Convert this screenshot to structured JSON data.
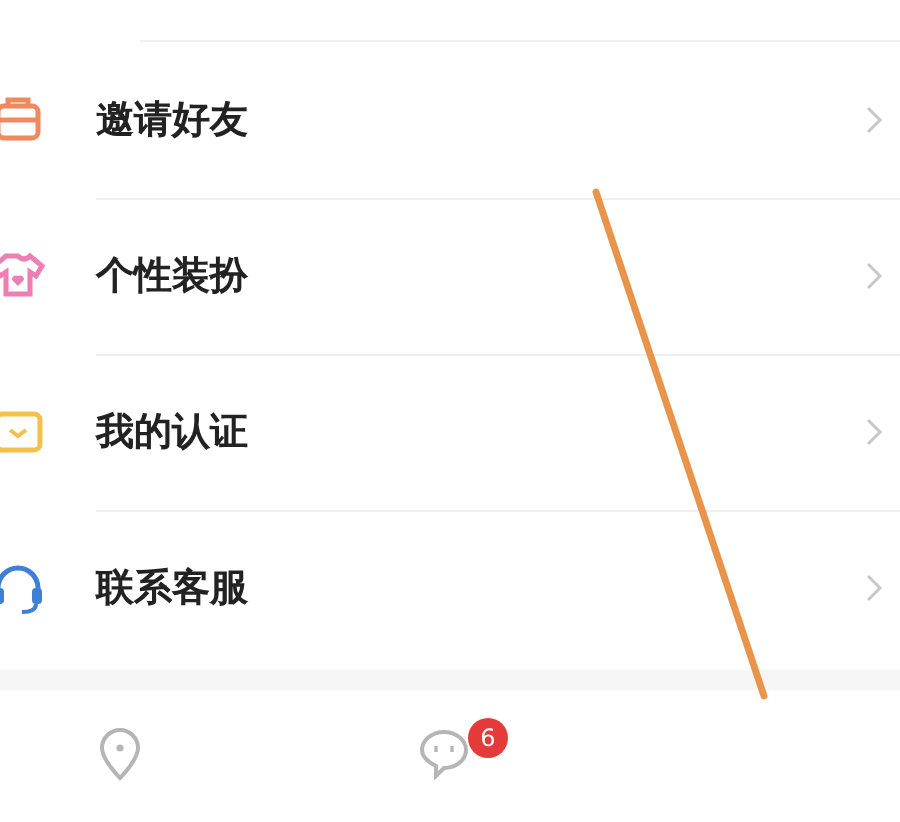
{
  "menu": [
    {
      "label": "邀请好友",
      "kind": "gift",
      "color": "#ee8a5e"
    },
    {
      "label": "个性装扮",
      "kind": "shirt",
      "color": "#ee7fb4"
    },
    {
      "label": "我的认证",
      "kind": "badge",
      "color": "#f2c14a"
    },
    {
      "label": "联系客服",
      "kind": "headset",
      "color": "#3f7fd6"
    }
  ],
  "tab_bar": [
    {
      "kind": "location"
    },
    {
      "kind": "chat",
      "badge": "6"
    }
  ]
}
